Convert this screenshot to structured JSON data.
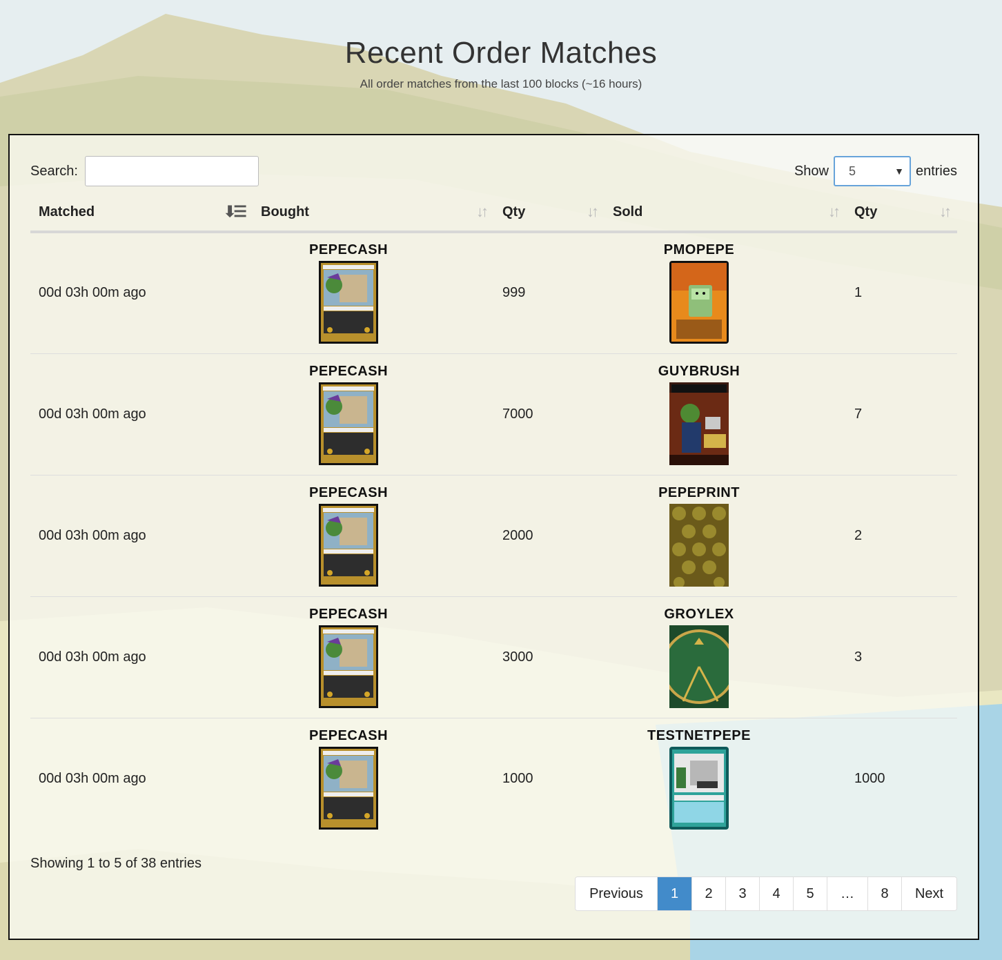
{
  "header": {
    "title": "Recent Order Matches",
    "subtitle": "All order matches from the last 100 blocks (~16 hours)"
  },
  "controls": {
    "search_label": "Search:",
    "search_value": "",
    "show_label": "Show",
    "show_value": "5",
    "entries_label": "entries"
  },
  "table": {
    "columns": [
      "Matched",
      "Bought",
      "Qty",
      "Sold",
      "Qty"
    ],
    "rows": [
      {
        "matched": "00d 03h 00m ago",
        "bought": "PEPECASH",
        "bought_qty": "999",
        "sold": "PMOPEPE",
        "sold_qty": "1"
      },
      {
        "matched": "00d 03h 00m ago",
        "bought": "PEPECASH",
        "bought_qty": "7000",
        "sold": "GUYBRUSH",
        "sold_qty": "7"
      },
      {
        "matched": "00d 03h 00m ago",
        "bought": "PEPECASH",
        "bought_qty": "2000",
        "sold": "PEPEPRINT",
        "sold_qty": "2"
      },
      {
        "matched": "00d 03h 00m ago",
        "bought": "PEPECASH",
        "bought_qty": "3000",
        "sold": "GROYLEX",
        "sold_qty": "3"
      },
      {
        "matched": "00d 03h 00m ago",
        "bought": "PEPECASH",
        "bought_qty": "1000",
        "sold": "TESTNETPEPE",
        "sold_qty": "1000"
      }
    ]
  },
  "footer": {
    "info": "Showing 1 to 5 of 38 entries",
    "pagination": [
      "Previous",
      "1",
      "2",
      "3",
      "4",
      "5",
      "…",
      "8",
      "Next"
    ],
    "active_page": "1"
  },
  "colors": {
    "accent": "#428bca",
    "card_border_gold": "#b8902c"
  }
}
